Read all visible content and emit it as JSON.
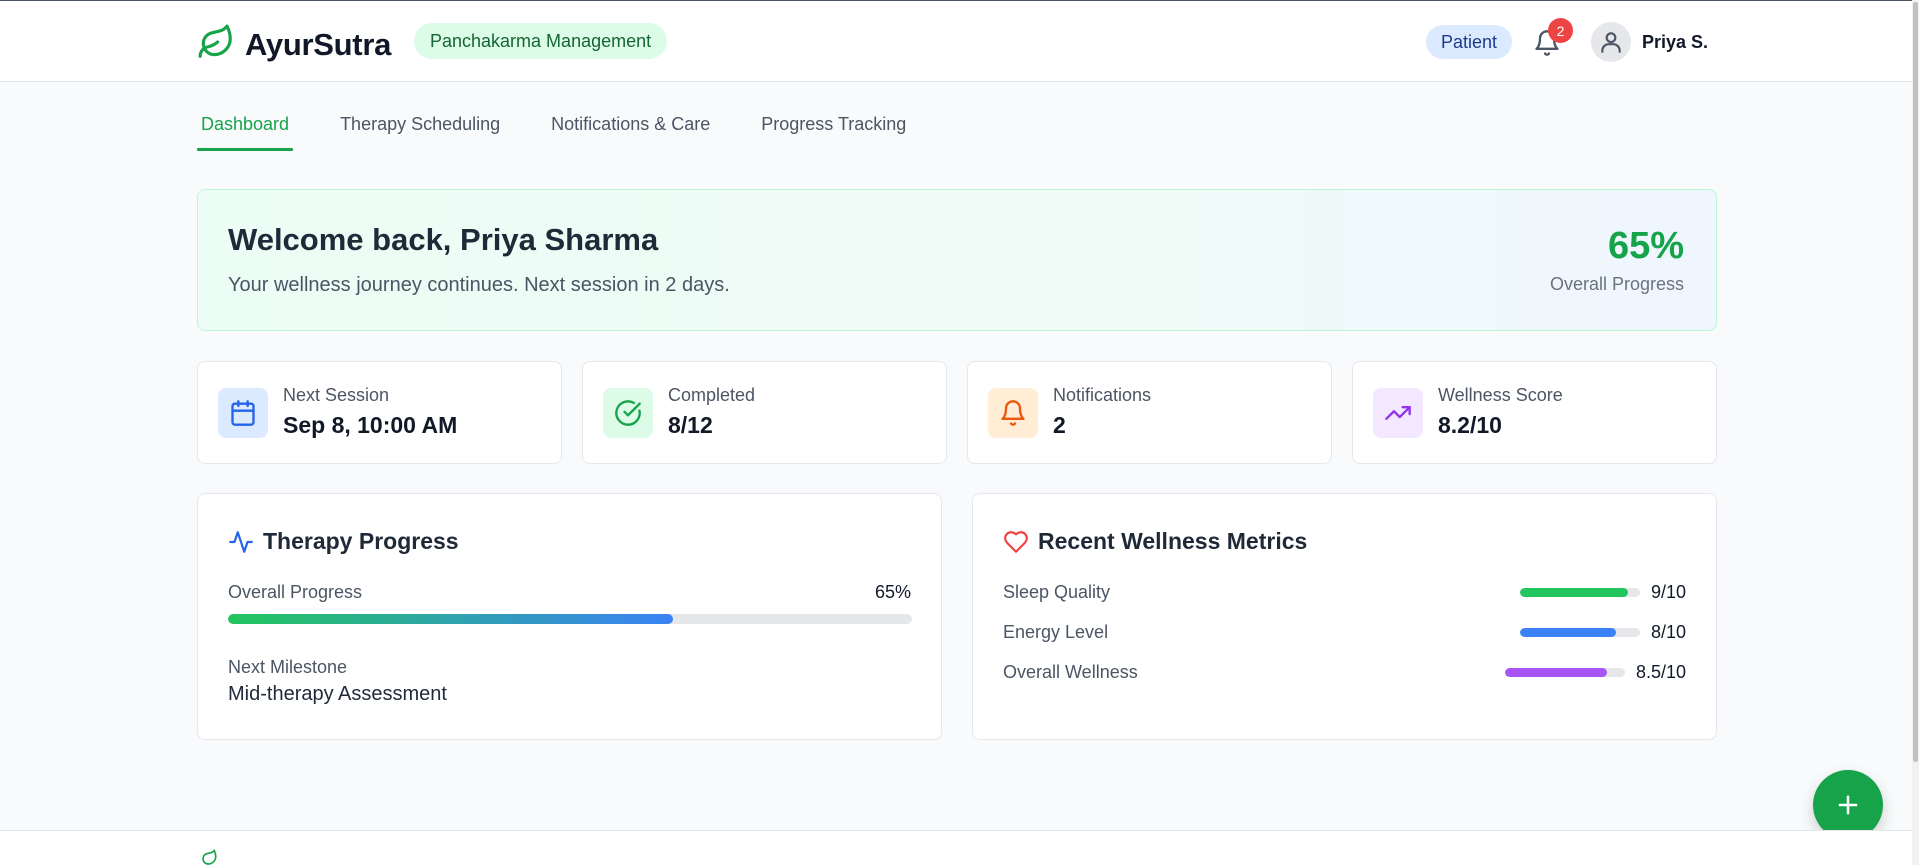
{
  "header": {
    "app_name": "AyurSutra",
    "subtitle": "Panchakarma Management",
    "role": "Patient",
    "notification_count": "2",
    "user_name": "Priya S."
  },
  "tabs": [
    {
      "label": "Dashboard",
      "active": true
    },
    {
      "label": "Therapy Scheduling",
      "active": false
    },
    {
      "label": "Notifications & Care",
      "active": false
    },
    {
      "label": "Progress Tracking",
      "active": false
    }
  ],
  "welcome": {
    "title": "Welcome back, Priya Sharma",
    "subtitle": "Your wellness journey continues. Next session in 2 days.",
    "progress_value": "65%",
    "progress_label": "Overall Progress"
  },
  "stats": [
    {
      "label": "Next Session",
      "value": "Sep 8, 10:00 AM",
      "icon": "calendar-icon",
      "bg": "#dbeafe",
      "color": "#2563eb"
    },
    {
      "label": "Completed",
      "value": "8/12",
      "icon": "check-circle-icon",
      "bg": "#dcfce7",
      "color": "#16a34a"
    },
    {
      "label": "Notifications",
      "value": "2",
      "icon": "bell-icon",
      "bg": "#ffedd5",
      "color": "#ea580c"
    },
    {
      "label": "Wellness Score",
      "value": "8.2/10",
      "icon": "trending-up-icon",
      "bg": "#f3e8ff",
      "color": "#9333ea"
    }
  ],
  "therapy_progress": {
    "title": "Therapy Progress",
    "overall_label": "Overall Progress",
    "overall_value": "65%",
    "overall_fraction": 0.65,
    "milestone_label": "Next Milestone",
    "milestone_value": "Mid-therapy Assessment"
  },
  "wellness_metrics": {
    "title": "Recent Wellness Metrics",
    "items": [
      {
        "label": "Sleep Quality",
        "value": "9/10",
        "fraction": 0.9,
        "color": "#22c55e"
      },
      {
        "label": "Energy Level",
        "value": "8/10",
        "fraction": 0.8,
        "color": "#3b82f6"
      },
      {
        "label": "Overall Wellness",
        "value": "8.5/10",
        "fraction": 0.85,
        "color": "#a855f7"
      }
    ]
  },
  "colors": {
    "brand_green": "#16a34a",
    "badge_red": "#ef4444"
  }
}
